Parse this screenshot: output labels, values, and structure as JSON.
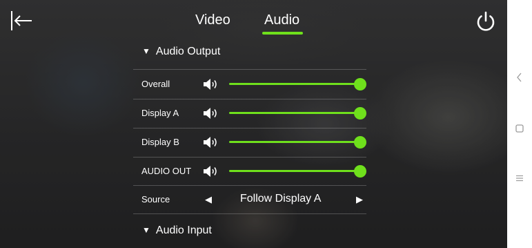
{
  "tabs": [
    {
      "label": "Video"
    },
    {
      "label": "Audio",
      "active": true
    }
  ],
  "sections": {
    "output_title": "Audio Output",
    "input_title": "Audio Input"
  },
  "audio_output": [
    {
      "label": "Overall",
      "level": 1.0
    },
    {
      "label": "Display A",
      "level": 1.0
    },
    {
      "label": "Display B",
      "level": 1.0
    },
    {
      "label": "AUDIO OUT",
      "level": 1.0
    }
  ],
  "source": {
    "label": "Source",
    "value": "Follow Display A"
  },
  "glyphs": {
    "expanded": "▼",
    "prev": "◀",
    "next": "▶"
  },
  "colors": {
    "accent": "#6fe01c",
    "text": "#ffffff"
  },
  "icons": {
    "back": "exit-arrow-icon",
    "power": "power-icon",
    "speaker": "speaker-icon",
    "nav_back": "chevron-left-icon",
    "nav_home": "square-icon",
    "nav_menu": "menu-icon"
  }
}
